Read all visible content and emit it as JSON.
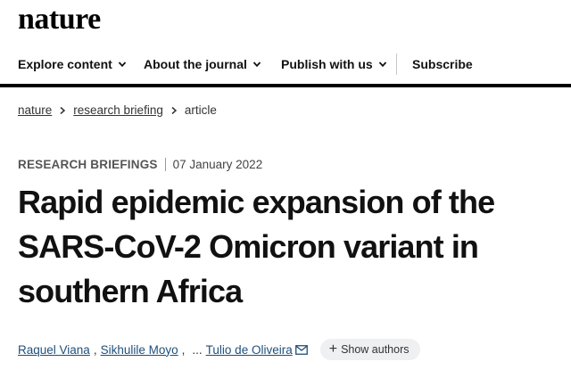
{
  "header": {
    "logo": "nature",
    "nav": [
      {
        "label": "Explore content",
        "icon": "chevron-down-icon"
      },
      {
        "label": "About the journal",
        "icon": "chevron-down-icon"
      },
      {
        "label": "Publish with us",
        "icon": "chevron-down-icon"
      }
    ],
    "subscribe_label": "Subscribe"
  },
  "breadcrumb": [
    "nature",
    "research briefing",
    "article"
  ],
  "article": {
    "type": "RESEARCH BRIEFINGS",
    "date": "07 January 2022",
    "title": "Rapid epidemic expansion of the SARS-CoV-2 Omicron variant in southern Africa",
    "authors": [
      "Raquel Viana",
      "Sikhulile Moyo",
      "Tulio de Oliveira"
    ],
    "author_separator": ",",
    "ellipsis": "...",
    "show_authors_label": "Show authors"
  },
  "colors": {
    "link": "#1f4f7a",
    "pill_bg": "#eef0f2"
  }
}
